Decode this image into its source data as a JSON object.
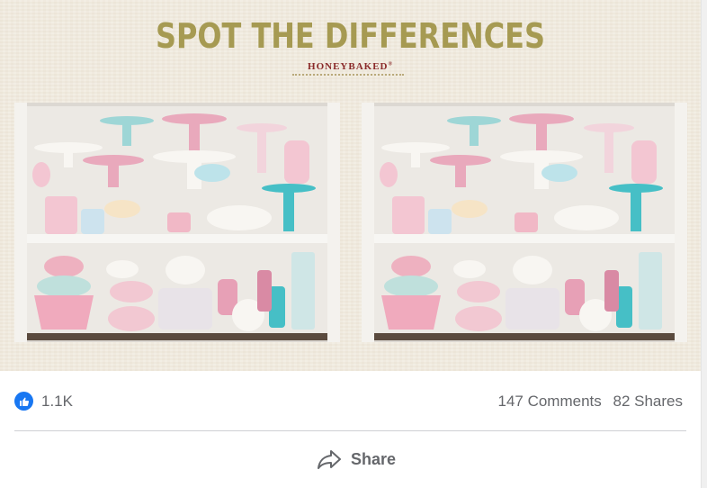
{
  "promo": {
    "title": "SPOT THE DIFFERENCES",
    "brand": "HONEYBAKED",
    "trademark": "®"
  },
  "colors": {
    "title": "#a69a52",
    "brand": "#8a2a2a",
    "facebook_blue": "#1877f2",
    "meta_text": "#65676b"
  },
  "reactions": {
    "icon": "like-icon",
    "count": "1.1K"
  },
  "engagement": {
    "comments": "147 Comments",
    "shares": "82 Shares"
  },
  "actions": {
    "share_icon": "share-arrow-icon",
    "share_label": "Share"
  }
}
